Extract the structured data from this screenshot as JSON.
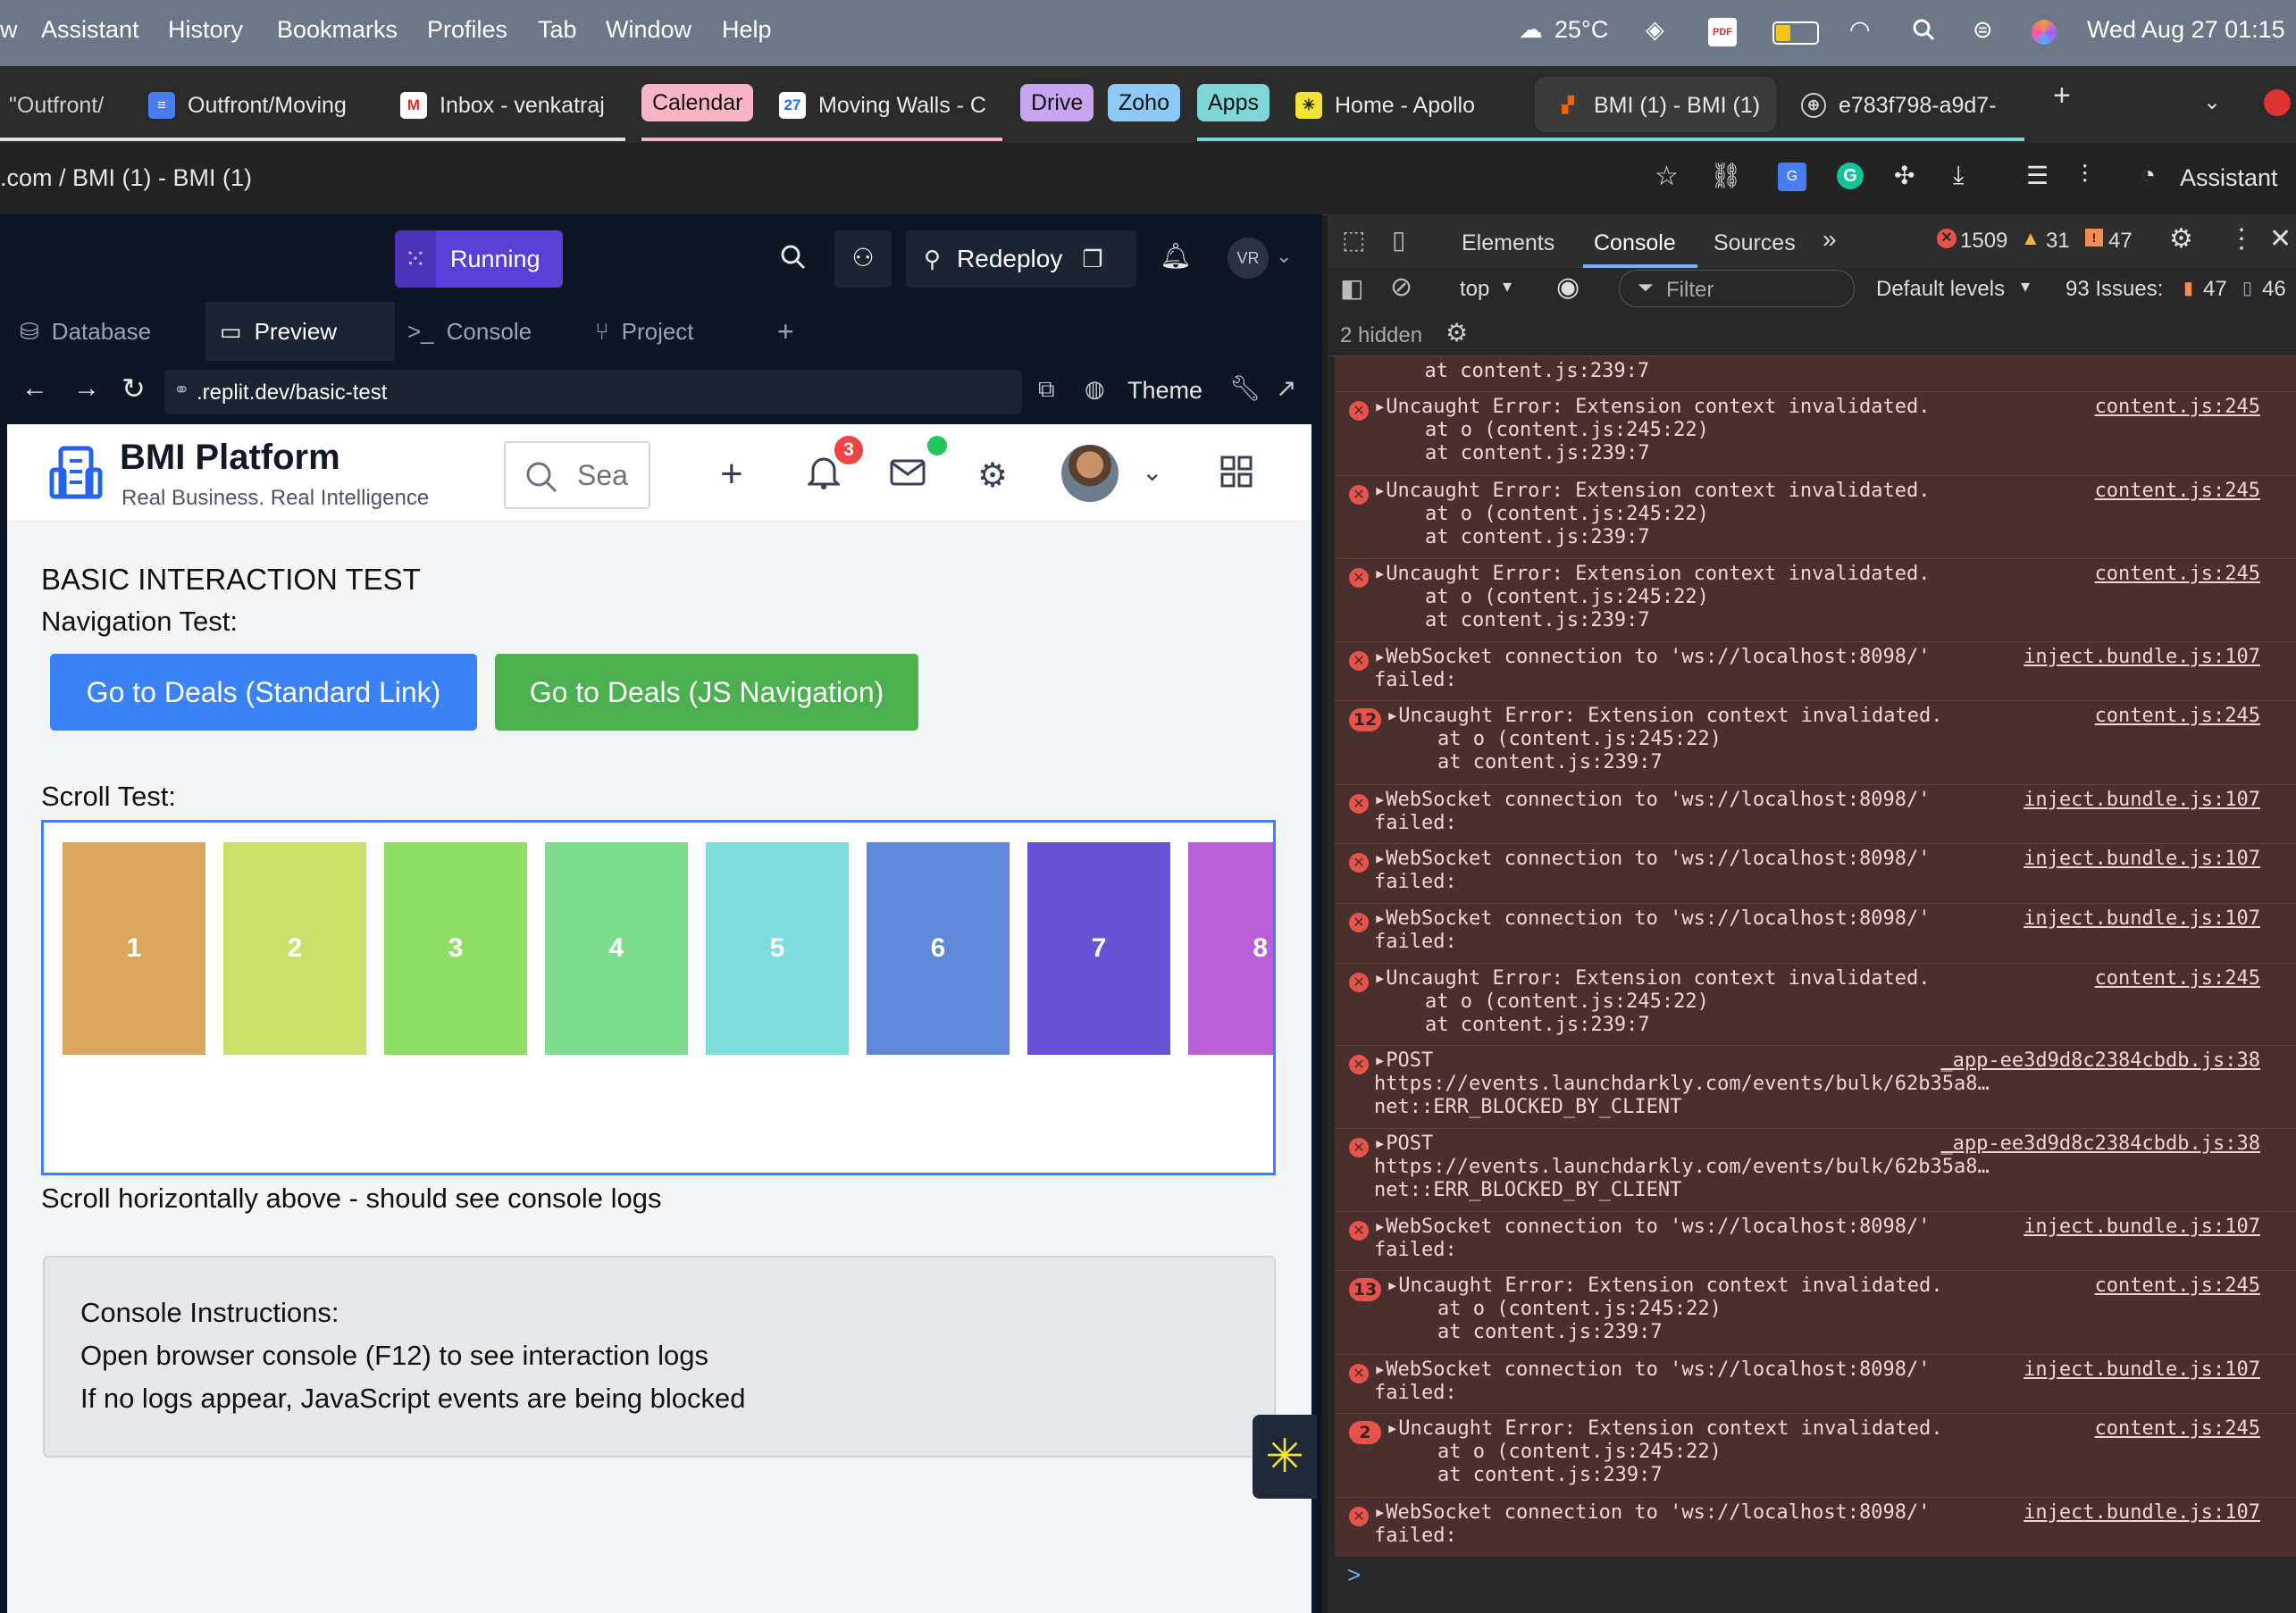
{
  "menubar": {
    "items": [
      "w",
      "Assistant",
      "History",
      "Bookmarks",
      "Profiles",
      "Tab",
      "Window",
      "Help"
    ],
    "weather": "25°C",
    "datetime": "Wed Aug 27  01:15"
  },
  "tabs": {
    "t0": "\"Outfront/",
    "t1": "Outfront/Moving",
    "t2": "Inbox - venkatraj",
    "calendar": "Calendar",
    "t3": "Moving Walls - C",
    "drive": "Drive",
    "zoho": "Zoho",
    "apps": "Apps",
    "t4": "Home - Apollo",
    "t5": "BMI (1) - BMI (1)",
    "t6": "e783f798-a9d7-",
    "plus": "+"
  },
  "address": {
    "url": ".com / BMI (1) - BMI (1)",
    "assistant": "Assistant"
  },
  "replit": {
    "running": "Running",
    "redeploy": "Redeploy",
    "avatar": "VR",
    "tabs": [
      "Database",
      "Preview",
      "Console",
      "Project"
    ],
    "plus": "+",
    "preview_url": ".replit.dev/basic-test",
    "theme": "Theme"
  },
  "app": {
    "brand": "BMI Platform",
    "tagline": "Real Business. Real Intelligence",
    "search_placeholder": "Sea",
    "notif_count": "3"
  },
  "content": {
    "heading": "BASIC INTERACTION TEST",
    "nav_label": "Navigation Test:",
    "btn_standard": "Go to Deals (Standard Link)",
    "btn_js": "Go to Deals (JS Navigation)",
    "scroll_label": "Scroll Test:",
    "boxes": [
      "1",
      "2",
      "3",
      "4",
      "5",
      "6",
      "7",
      "8"
    ],
    "box_colors": [
      "#d9a85d",
      "#c9e06b",
      "#8fdf66",
      "#7ddd8e",
      "#7ddcdc",
      "#5f88d9",
      "#6a52d6",
      "#b85ed6"
    ],
    "scroll_hint": "Scroll horizontally above - should see console logs",
    "console_title": "Console Instructions:",
    "console_line1": "Open browser console (F12) to see interaction logs",
    "console_line2": "If no logs appear, JavaScript events are being blocked"
  },
  "devtools": {
    "tabs": [
      "Elements",
      "Console",
      "Sources"
    ],
    "errors": "1509",
    "warnings": "31",
    "info": "47",
    "context": "top",
    "filter": "Filter",
    "levels": "Default levels",
    "issues_label": "93 Issues:",
    "issues_a": "47",
    "issues_b": "46",
    "hidden": "2 hidden",
    "prompt": ">",
    "logs": [
      {
        "count": "",
        "l1": "",
        "l2": "  at content.js:239:7",
        "l3": "",
        "src": ""
      },
      {
        "count": "",
        "l1": "▸Uncaught Error: Extension context invalidated.",
        "l2": "    at o (content.js:245:22)",
        "l3": "    at content.js:239:7",
        "src": "content.js:245"
      },
      {
        "count": "",
        "l1": "▸Uncaught Error: Extension context invalidated.",
        "l2": "    at o (content.js:245:22)",
        "l3": "    at content.js:239:7",
        "src": "content.js:245"
      },
      {
        "count": "",
        "l1": "▸Uncaught Error: Extension context invalidated.",
        "l2": "    at o (content.js:245:22)",
        "l3": "    at content.js:239:7",
        "src": "content.js:245"
      },
      {
        "count": "",
        "l1": "▸WebSocket connection to 'ws://localhost:8098/'",
        "l2": "failed:",
        "l3": "",
        "src": "inject.bundle.js:107"
      },
      {
        "count": "12",
        "l1": "▸Uncaught Error: Extension context invalidated.",
        "l2": "    at o (content.js:245:22)",
        "l3": "    at content.js:239:7",
        "src": "content.js:245"
      },
      {
        "count": "",
        "l1": "▸WebSocket connection to 'ws://localhost:8098/'",
        "l2": "failed:",
        "l3": "",
        "src": "inject.bundle.js:107"
      },
      {
        "count": "",
        "l1": "▸WebSocket connection to 'ws://localhost:8098/'",
        "l2": "failed:",
        "l3": "",
        "src": "inject.bundle.js:107"
      },
      {
        "count": "",
        "l1": "▸WebSocket connection to 'ws://localhost:8098/'",
        "l2": "failed:",
        "l3": "",
        "src": "inject.bundle.js:107"
      },
      {
        "count": "",
        "l1": "▸Uncaught Error: Extension context invalidated.",
        "l2": "    at o (content.js:245:22)",
        "l3": "    at content.js:239:7",
        "src": "content.js:245"
      },
      {
        "count": "",
        "l1": "▸POST",
        "l2": "https://events.launchdarkly.com/events/bulk/62b35a8…",
        "l3": "net::ERR_BLOCKED_BY_CLIENT",
        "src": "_app-ee3d9d8c2384cbdb.js:38"
      },
      {
        "count": "",
        "l1": "▸POST",
        "l2": "https://events.launchdarkly.com/events/bulk/62b35a8…",
        "l3": "net::ERR_BLOCKED_BY_CLIENT",
        "src": "_app-ee3d9d8c2384cbdb.js:38"
      },
      {
        "count": "",
        "l1": "▸WebSocket connection to 'ws://localhost:8098/'",
        "l2": "failed:",
        "l3": "",
        "src": "inject.bundle.js:107"
      },
      {
        "count": "13",
        "l1": "▸Uncaught Error: Extension context invalidated.",
        "l2": "    at o (content.js:245:22)",
        "l3": "    at content.js:239:7",
        "src": "content.js:245"
      },
      {
        "count": "",
        "l1": "▸WebSocket connection to 'ws://localhost:8098/'",
        "l2": "failed:",
        "l3": "",
        "src": "inject.bundle.js:107"
      },
      {
        "count": "2",
        "l1": "▸Uncaught Error: Extension context invalidated.",
        "l2": "    at o (content.js:245:22)",
        "l3": "    at content.js:239:7",
        "src": "content.js:245"
      },
      {
        "count": "",
        "l1": "▸WebSocket connection to 'ws://localhost:8098/'",
        "l2": "failed:",
        "l3": "",
        "src": "inject.bundle.js:107"
      }
    ]
  }
}
